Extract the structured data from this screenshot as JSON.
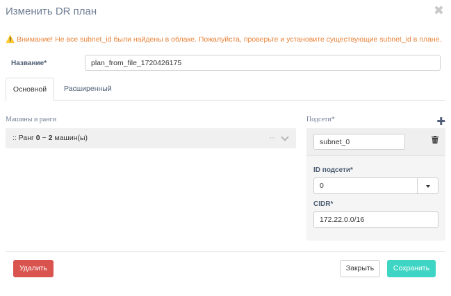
{
  "modal": {
    "title": "Изменить DR план",
    "close_glyph": "✖"
  },
  "warning": {
    "icon": "⚠️",
    "text": "Внимание! Не все subnet_id были найдены в облаке. Пожалуйста, проверьте и установите существующие subnet_id в плане."
  },
  "name_field": {
    "label": "Название*",
    "value": "plan_from_file_1720426175"
  },
  "tabs": [
    {
      "label": "Основной",
      "active": true
    },
    {
      "label": "Расширенный",
      "active": false
    }
  ],
  "machines": {
    "label": "Машины и ранги",
    "rank_prefix": ":: Ранг ",
    "rank_number": "0",
    "rank_separator": " − ",
    "rank_count": "2",
    "rank_suffix": " машин(ы)",
    "menu_glyph": "···"
  },
  "subnets": {
    "label": "Подсети*",
    "add_glyph": "✚",
    "items": [
      {
        "name": "subnet_0",
        "id_label": "ID подсети*",
        "id_value": "0",
        "cidr_label": "CIDR*",
        "cidr_value": "172.22.0.0/16"
      }
    ]
  },
  "footer": {
    "delete_label": "Удалить",
    "close_label": "Закрыть",
    "save_label": "Сохранить"
  },
  "colors": {
    "delete": "#d9534f",
    "save": "#3fd5c4",
    "warning": "#e8833a",
    "label": "#4b5b72"
  }
}
